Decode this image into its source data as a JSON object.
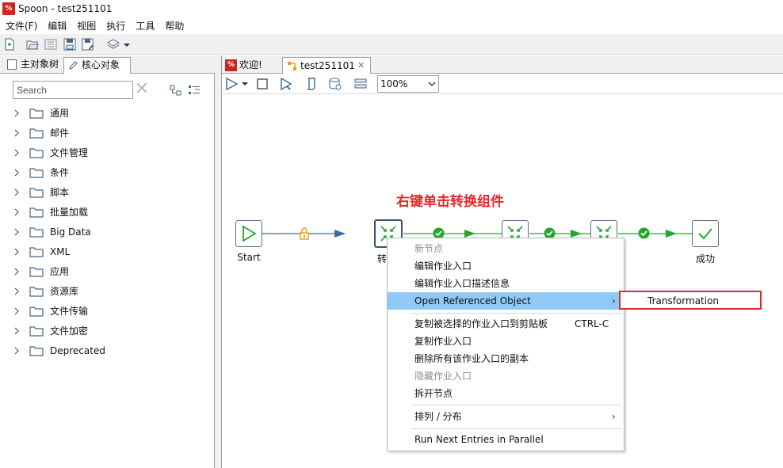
{
  "window": {
    "title": "Spoon - test251101",
    "app_icon_text": "%"
  },
  "menubar": {
    "items": [
      "文件(F)",
      "编辑",
      "视图",
      "执行",
      "工具",
      "帮助"
    ]
  },
  "toolbar": {
    "icons": [
      "new-file-icon",
      "open-icon",
      "explore-icon",
      "save-icon",
      "save-as-icon",
      "layers-icon",
      "dropdown-icon"
    ]
  },
  "left_panel": {
    "tabs": [
      {
        "label": "主对象树",
        "icon": "tree-icon",
        "active": false
      },
      {
        "label": "核心对象",
        "icon": "pencil-icon",
        "active": true
      }
    ],
    "search": {
      "placeholder": "Search",
      "value": ""
    },
    "tree": [
      {
        "label": "通用"
      },
      {
        "label": "邮件"
      },
      {
        "label": "文件管理"
      },
      {
        "label": "条件"
      },
      {
        "label": "脚本"
      },
      {
        "label": "批量加载"
      },
      {
        "label": "Big Data"
      },
      {
        "label": "XML"
      },
      {
        "label": "应用"
      },
      {
        "label": "资源库"
      },
      {
        "label": "文件传输"
      },
      {
        "label": "文件加密"
      },
      {
        "label": "Deprecated"
      }
    ]
  },
  "editor": {
    "tabs": [
      {
        "label": "欢迎!",
        "icon": "spoon-icon",
        "active": false
      },
      {
        "label": "test251101",
        "icon": "job-icon",
        "active": true,
        "close": "✕"
      }
    ],
    "zoom": "100%"
  },
  "canvas": {
    "annotation": "右键单击转换组件",
    "nodes": [
      {
        "id": "start",
        "label": "Start",
        "icon": "play-icon"
      },
      {
        "id": "trans1",
        "label": "转",
        "icon": "transformation-icon",
        "selected": true
      },
      {
        "id": "trans2",
        "label": "",
        "icon": "transformation-icon"
      },
      {
        "id": "trans3",
        "label": "",
        "icon": "transformation-icon"
      },
      {
        "id": "success",
        "label": "成功",
        "icon": "checkmark-icon"
      }
    ],
    "colors": {
      "hop": "#3d6e99",
      "hop_ok": "#1fa830",
      "lock": "#f0a000",
      "node_border": "#57708a"
    }
  },
  "context_menu": {
    "items": [
      {
        "label": "新节点",
        "disabled": true
      },
      {
        "label": "编辑作业入口"
      },
      {
        "label": "编辑作业入口描述信息"
      },
      {
        "label": "Open Referenced Object",
        "submenu": true,
        "hover": true
      },
      {
        "label": "复制被选择的作业入口到剪贴板",
        "shortcut": "CTRL-C"
      },
      {
        "label": "复制作业入口"
      },
      {
        "label": "删除所有该作业入口的副本"
      },
      {
        "label": "隐藏作业入口",
        "disabled": true
      },
      {
        "label": "拆开节点"
      },
      {
        "label": "排列 / 分布",
        "submenu": true
      },
      {
        "label": "Run Next Entries in Parallel"
      }
    ],
    "arrow": "›",
    "submenu": {
      "label": "Transformation",
      "highlight_color": "#e0262b"
    }
  }
}
